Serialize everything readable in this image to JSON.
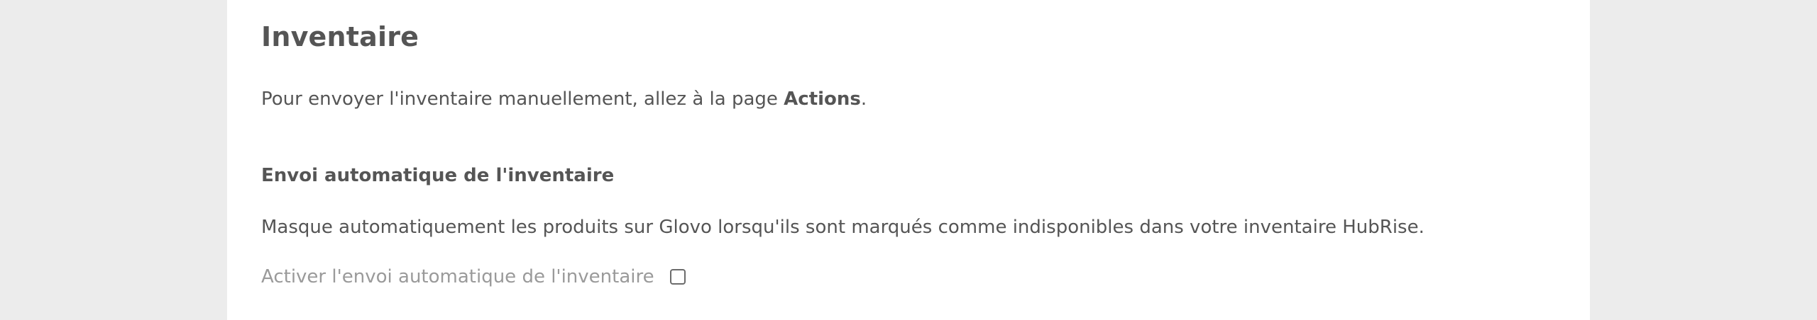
{
  "section": {
    "title": "Inventaire",
    "intro_prefix": "Pour envoyer l'inventaire manuellement, allez à la page ",
    "intro_link": "Actions",
    "intro_suffix": "."
  },
  "auto_send": {
    "title": "Envoi automatique de l'inventaire",
    "description": "Masque automatiquement les produits sur Glovo lorsqu'ils sont marqués comme indisponibles dans votre inventaire HubRise.",
    "toggle_label": "Activer l'envoi automatique de l'inventaire",
    "checked": false
  }
}
